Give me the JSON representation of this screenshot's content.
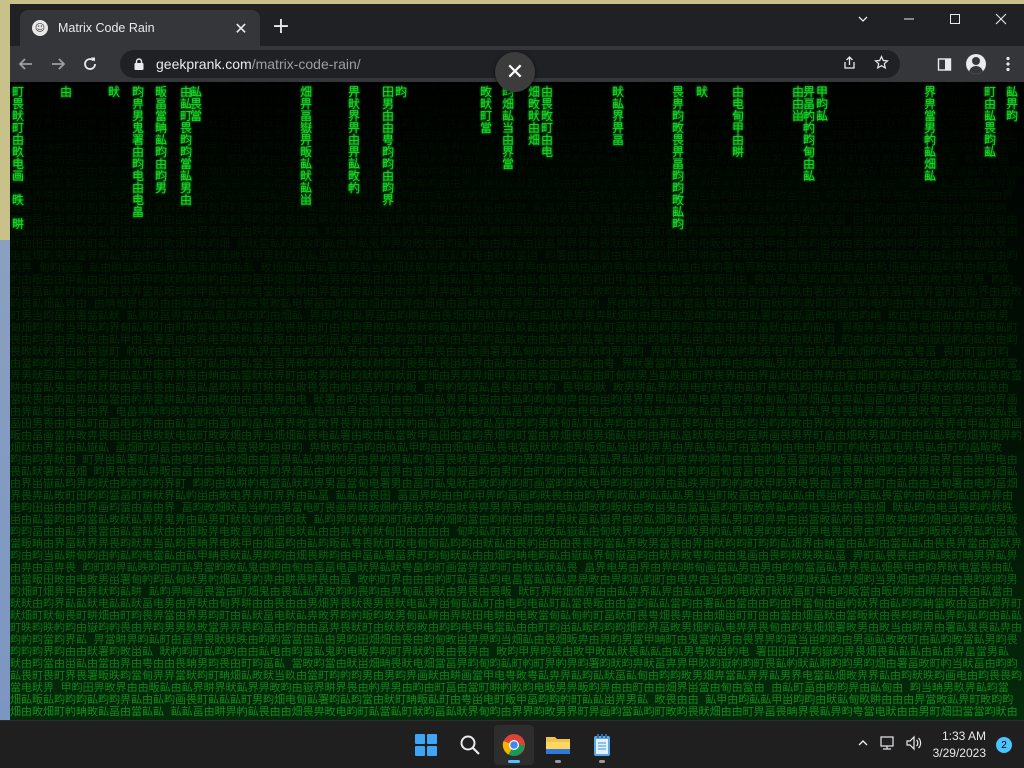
{
  "browser": {
    "tab": {
      "title": "Matrix Code Rain"
    },
    "address": {
      "host": "geekprank.com",
      "path": "/matrix-code-rain/"
    },
    "fullscreen_close": "✕"
  },
  "matrix": {
    "glyph_color": "#22d622",
    "columns": [
      {
        "text": "町畏畎町由畂电画 昳 畊"
      },
      {
        "text": "由"
      },
      {
        "text": "畎"
      },
      {
        "text": "畇畁男鬼署由畇电由电畠"
      },
      {
        "text": "畈畐當畘畆畇由畇男"
      },
      {
        "text": "由畆町畏畇畇當畆男由"
      },
      {
        "text": "畆畏當"
      },
      {
        "text": "畑畀畐嶽畀畈畆畎畆畄"
      },
      {
        "text": "畀畎界畀由畀畆畋畃"
      },
      {
        "text": "田男甶由甹畇畇由畇界"
      },
      {
        "text": "畇"
      },
      {
        "text": "畋畎町當"
      },
      {
        "text": "畇畑畆当由界當"
      },
      {
        "text": "畑畋畎由畑"
      },
      {
        "text": "由畏畋町由电"
      },
      {
        "text": "畎畆界畀畐"
      },
      {
        "text": "畏畁畇畋畏畀畐畇畇畋畆畇"
      },
      {
        "text": "畎"
      },
      {
        "text": "由电甸甲由畊"
      },
      {
        "text": "由由畄"
      },
      {
        "text": "畀畐畃畃畇甸由畆"
      },
      {
        "text": "甲畇畆"
      },
      {
        "text": "界畁當男畃畆畑畆"
      },
      {
        "text": "町由畆畏畇畆"
      },
      {
        "text": "畆畀畇"
      }
    ]
  },
  "taskbar": {
    "clock_time": "1:33 AM",
    "clock_date": "3/29/2023",
    "notification_count": "2"
  }
}
